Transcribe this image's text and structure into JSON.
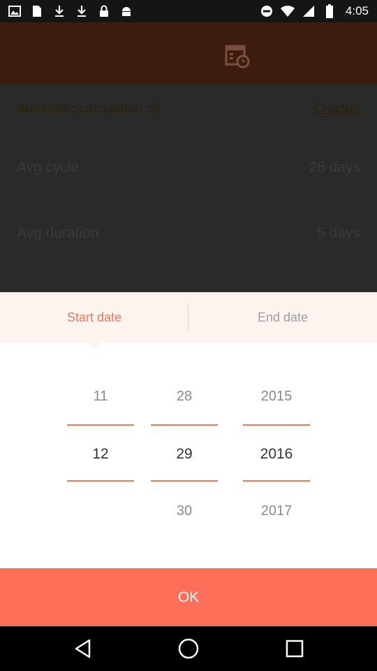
{
  "status_bar": {
    "time": "4:05",
    "left_icons": [
      "image-icon",
      "file-icon",
      "download-icon",
      "download-icon",
      "lock-icon",
      "android-icon"
    ],
    "right_icons": [
      "do-not-disturb-icon",
      "wifi-icon",
      "signal-icon",
      "battery-icon"
    ]
  },
  "background": {
    "row1_label": "Automatic calculation off",
    "row1_action": "Change",
    "row2_label": "Avg cycle",
    "row2_value": "28 days",
    "row3_label": "Avg duration",
    "row3_value": "5 days"
  },
  "dialog": {
    "tabs": [
      {
        "label": "Start date",
        "active": true
      },
      {
        "label": "End date",
        "active": false
      }
    ],
    "month": {
      "prev": "11",
      "current": "12",
      "next": ""
    },
    "day": {
      "prev": "28",
      "current": "29",
      "next": "30"
    },
    "year": {
      "prev": "2015",
      "current": "2016",
      "next": "2017"
    },
    "ok_label": "OK"
  },
  "colors": {
    "accent": "#ec7b5c",
    "ok_button": "#fe6f5a"
  }
}
